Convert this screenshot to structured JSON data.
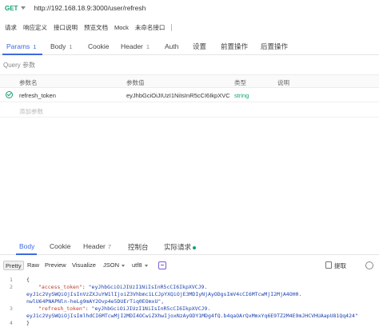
{
  "request": {
    "method": "GET",
    "url": "http://192.168.18.9:3000/user/refresh"
  },
  "toolbar": {
    "items": [
      "请求",
      "响应定义",
      "接口说明",
      "预览文档",
      "Mock",
      "未命名接口"
    ]
  },
  "tabs": [
    {
      "label": "Params",
      "count": "1"
    },
    {
      "label": "Body",
      "count": "1"
    },
    {
      "label": "Cookie",
      "count": ""
    },
    {
      "label": "Header",
      "count": "1"
    },
    {
      "label": "Auth",
      "count": ""
    },
    {
      "label": "设置",
      "count": ""
    },
    {
      "label": "前置操作",
      "count": ""
    },
    {
      "label": "后置操作",
      "count": ""
    }
  ],
  "query": {
    "title": "Query 参数",
    "columns": [
      "参数名",
      "参数值",
      "类型",
      "说明"
    ],
    "rows": [
      {
        "name": "refresh_token",
        "value": "eyJhbGciOiJIUzI1NiIsInR5cCI6IkpXVC",
        "type": "string",
        "desc": ""
      }
    ],
    "add_placeholder": "添加参数"
  },
  "response": {
    "tabs": [
      {
        "label": "Body",
        "count": ""
      },
      {
        "label": "Cookie",
        "count": ""
      },
      {
        "label": "Header",
        "count": "7"
      },
      {
        "label": "控制台",
        "count": ""
      },
      {
        "label": "实际请求",
        "count": ""
      }
    ],
    "formats": [
      "Pretty",
      "Raw",
      "Preview",
      "Visualize",
      "JSON",
      "utf8"
    ],
    "copy_label": "提取",
    "lines": [
      {
        "n": "1",
        "text": "{"
      },
      {
        "n": "2",
        "key": "\"access_token\"",
        "val": "\"eyJhbGciOiJIUzI1NiIsInR5cCI6IkpXVCJ9."
      },
      {
        "n": "",
        "cont": "eyJ1c2VySWQiOjIsInVzZXJuYW1lIjoiZ3Vhbmc1LCJpYXQiOjE3MDIyNjAyODgsImV4cCI6MTcwMjI2MjA4OH0."
      },
      {
        "n": "",
        "cont": "nwlU64PNAPNln-heLg9mAY2Ovp4e5DUErTiq0EOmxU\","
      },
      {
        "n": "3",
        "key": "\"refresh_token\"",
        "val": "\"eyJhbGciOiJIUzI1NiIsInR5cCI6IkpXVCJ9."
      },
      {
        "n": "",
        "cont": "eyJ1c2VySWQiOjIsImlhdCI6MTcwMjI2MDI4OCwiZXhwIjoxNzAyODY1MDg4fQ.b4qaOArQxMmxYq6E9TZ2M4E9mJHCVHUAapU81Qq424\""
      },
      {
        "n": "4",
        "text": "}"
      }
    ]
  },
  "colors": {
    "accent": "#3e6ae0",
    "method": "#12a26b",
    "string_type": "#12a26b"
  }
}
